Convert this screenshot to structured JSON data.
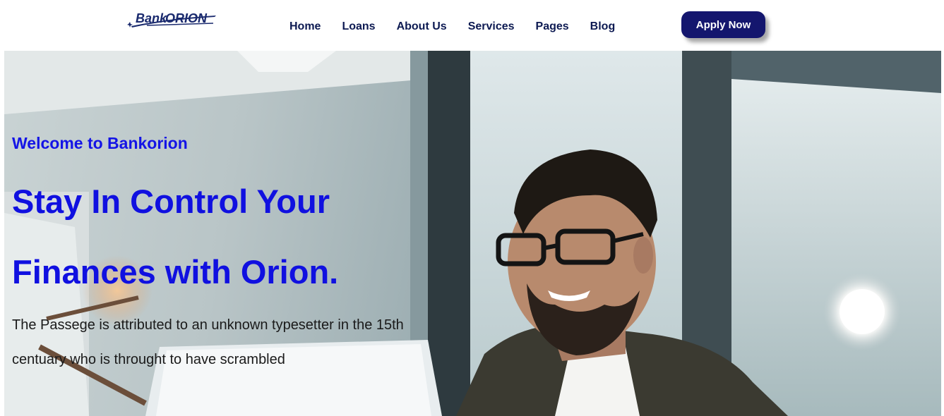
{
  "brand": {
    "name": "BankORION"
  },
  "nav": {
    "items": [
      {
        "label": "Home"
      },
      {
        "label": "Loans"
      },
      {
        "label": "About Us"
      },
      {
        "label": "Services"
      },
      {
        "label": "Pages"
      },
      {
        "label": "Blog"
      }
    ]
  },
  "header": {
    "apply_label": "Apply Now"
  },
  "hero": {
    "welcome": "Welcome to Bankorion",
    "headline_line1": "Stay In Control Your",
    "headline_line2": "Finances with Orion.",
    "description_line1": "The Passege is attributed to an unknown typesetter in the 15th",
    "description_line2": "centuary who is throught to have scrambled"
  },
  "colors": {
    "accent": "#1010e0",
    "nav_text": "#0d1a52",
    "button_bg": "#14166e"
  }
}
